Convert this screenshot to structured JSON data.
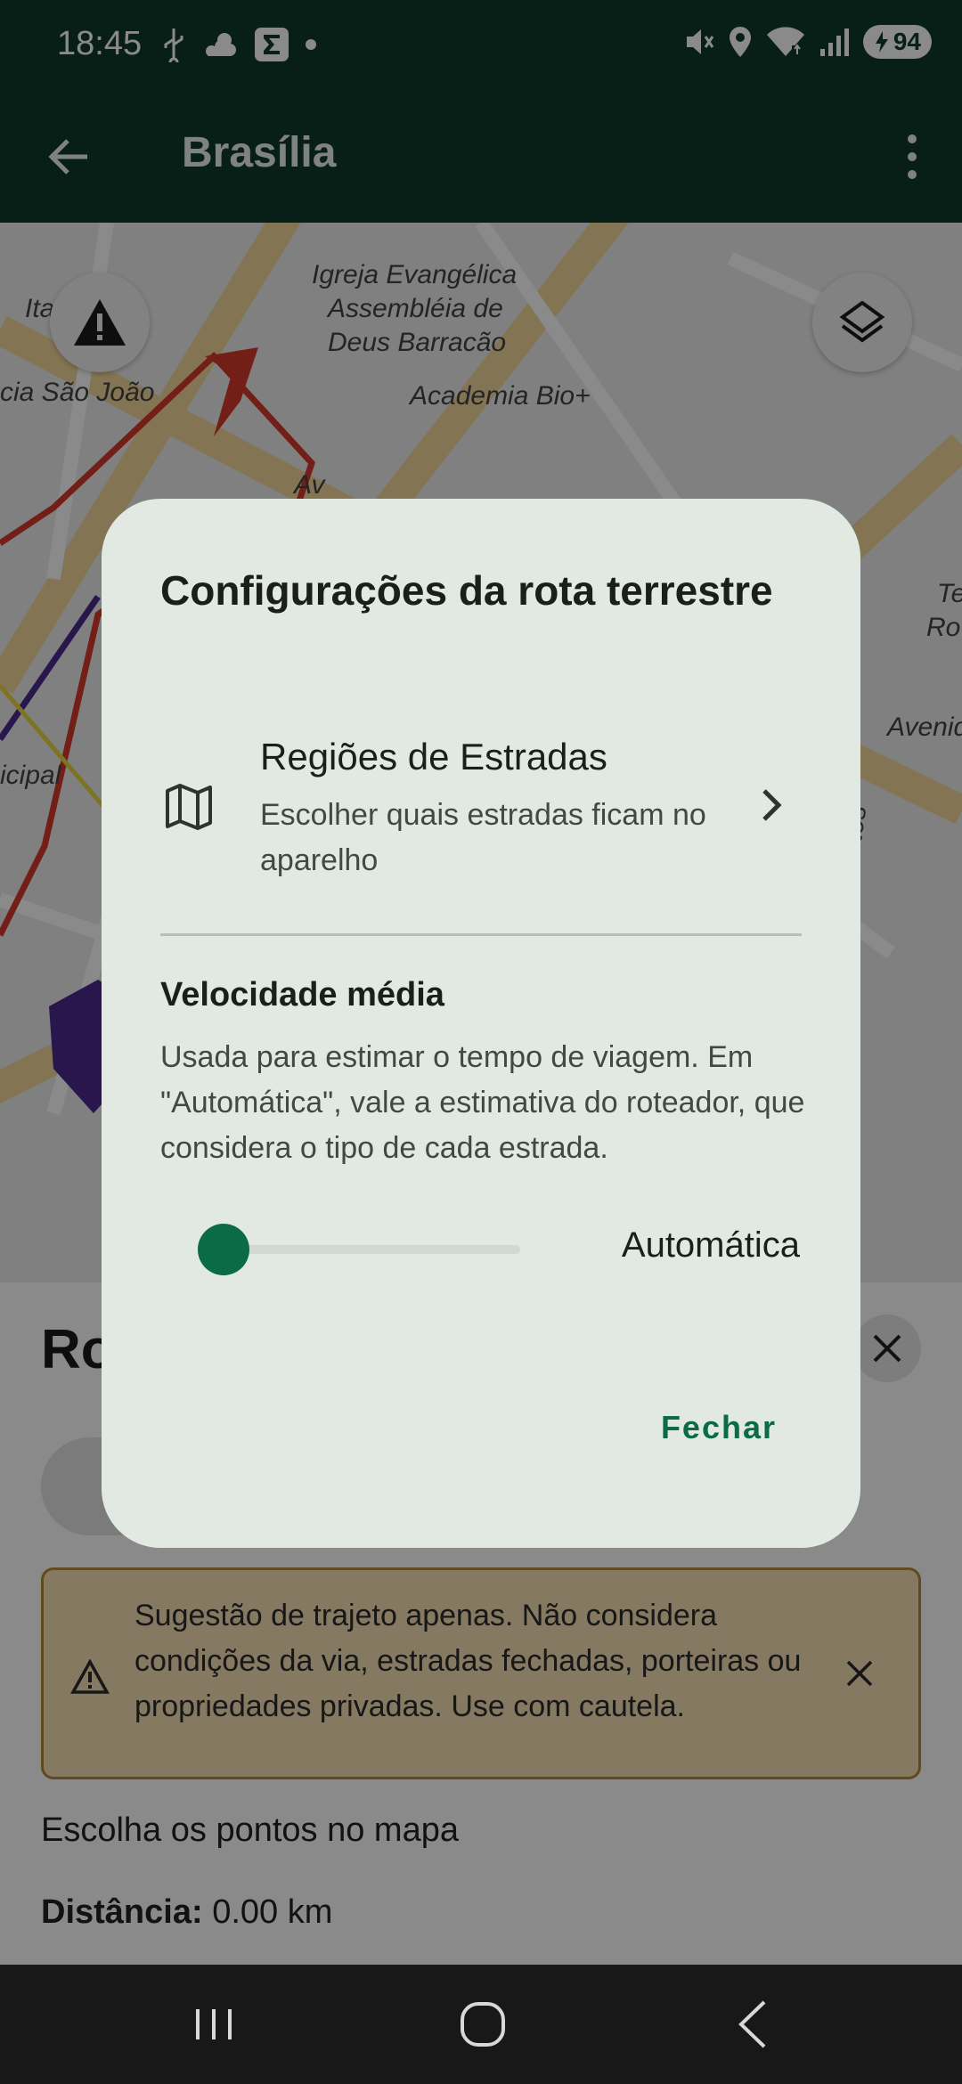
{
  "status_bar": {
    "time": "18:45",
    "battery": "94",
    "left_icons": [
      "usb-icon",
      "weather-icon",
      "sigma-app-icon",
      "dot-icon"
    ],
    "right_icons": [
      "mute-icon",
      "location-icon",
      "wifi-icon",
      "signal-icon",
      "battery-icon"
    ]
  },
  "app_bar": {
    "title": "Brasília",
    "back_icon": "arrow-back-icon",
    "more_icon": "more-vert-icon"
  },
  "map": {
    "labels": [
      "Igreja Evangélica",
      "Assembléia de",
      "Deus Barracão",
      "Academia Bio+",
      "Ita",
      "cia São João",
      "Av",
      "icipal",
      "Avenid",
      "Te",
      "Ro",
      "ugusto dos Santos"
    ],
    "alert_icon": "warning-icon",
    "layers_icon": "layers-icon"
  },
  "sheet": {
    "title": "Ro",
    "warning_text": "Sugestão de trajeto apenas. Não considera condições da via, estradas fechadas, porteiras ou propriedades privadas. Use com cautela.",
    "pick_points": "Escolha os pontos no mapa",
    "distance_label": "Distância:",
    "distance_value": "0.00 km"
  },
  "dialog": {
    "title": "Configurações da rota terrestre",
    "regions": {
      "title": "Regiões de Estradas",
      "subtitle": "Escolher quais estradas ficam no aparelho"
    },
    "speed": {
      "title": "Velocidade média",
      "description": "Usada para estimar o tempo de viagem. Em \"Automática\", vale a estimativa do roteador, que considera o tipo de cada estrada.",
      "value_label": "Automática",
      "slider_fraction": 0.0
    },
    "close_label": "Fechar"
  },
  "colors": {
    "primary_dark": "#0e3a2a",
    "accent": "#0b6b48",
    "dialog_bg": "#e2e9e3",
    "warning_bg": "#f6dfb5"
  }
}
